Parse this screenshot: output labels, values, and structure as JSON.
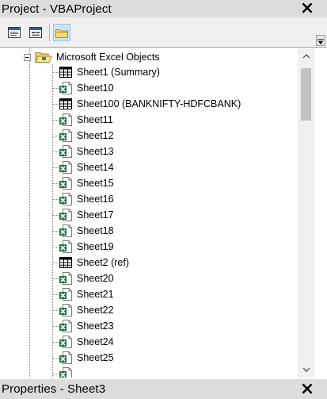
{
  "project_panel": {
    "title": "Project - VBAProject",
    "close_glyph": "×"
  },
  "toolbar": {
    "buttons": [
      {
        "name": "view-code-icon"
      },
      {
        "name": "view-object-icon"
      },
      {
        "name": "toggle-folders-icon",
        "active": true
      }
    ]
  },
  "tree": {
    "folder": {
      "label": "Microsoft Excel Objects",
      "icon": "folder-open-icon",
      "expander": "minus"
    },
    "items": [
      {
        "label": "Sheet1 (Summary)",
        "icon": "worksheet-grid-icon"
      },
      {
        "label": "Sheet10",
        "icon": "excel-sheet-icon"
      },
      {
        "label": "Sheet100 (BANKNIFTY-HDFCBANK)",
        "icon": "worksheet-grid-icon"
      },
      {
        "label": "Sheet11",
        "icon": "excel-sheet-icon"
      },
      {
        "label": "Sheet12",
        "icon": "excel-sheet-icon"
      },
      {
        "label": "Sheet13",
        "icon": "excel-sheet-icon"
      },
      {
        "label": "Sheet14",
        "icon": "excel-sheet-icon"
      },
      {
        "label": "Sheet15",
        "icon": "excel-sheet-icon"
      },
      {
        "label": "Sheet16",
        "icon": "excel-sheet-icon"
      },
      {
        "label": "Sheet17",
        "icon": "excel-sheet-icon"
      },
      {
        "label": "Sheet18",
        "icon": "excel-sheet-icon"
      },
      {
        "label": "Sheet19",
        "icon": "excel-sheet-icon"
      },
      {
        "label": "Sheet2 (ref)",
        "icon": "worksheet-grid-icon"
      },
      {
        "label": "Sheet20",
        "icon": "excel-sheet-icon"
      },
      {
        "label": "Sheet21",
        "icon": "excel-sheet-icon"
      },
      {
        "label": "Sheet22",
        "icon": "excel-sheet-icon"
      },
      {
        "label": "Sheet23",
        "icon": "excel-sheet-icon"
      },
      {
        "label": "Sheet24",
        "icon": "excel-sheet-icon"
      },
      {
        "label": "Sheet25",
        "icon": "excel-sheet-icon"
      },
      {
        "label": "",
        "icon": "excel-sheet-icon"
      }
    ]
  },
  "scrollbar": {
    "up_glyph": "^",
    "down_glyph": "v"
  },
  "properties_panel": {
    "title": "Properties - Sheet3",
    "close_glyph": "×"
  },
  "colors": {
    "titlebar_bg": "#dcdcdc",
    "excel_green": "#1e7145",
    "scroll_thumb": "#c1c1c1"
  }
}
